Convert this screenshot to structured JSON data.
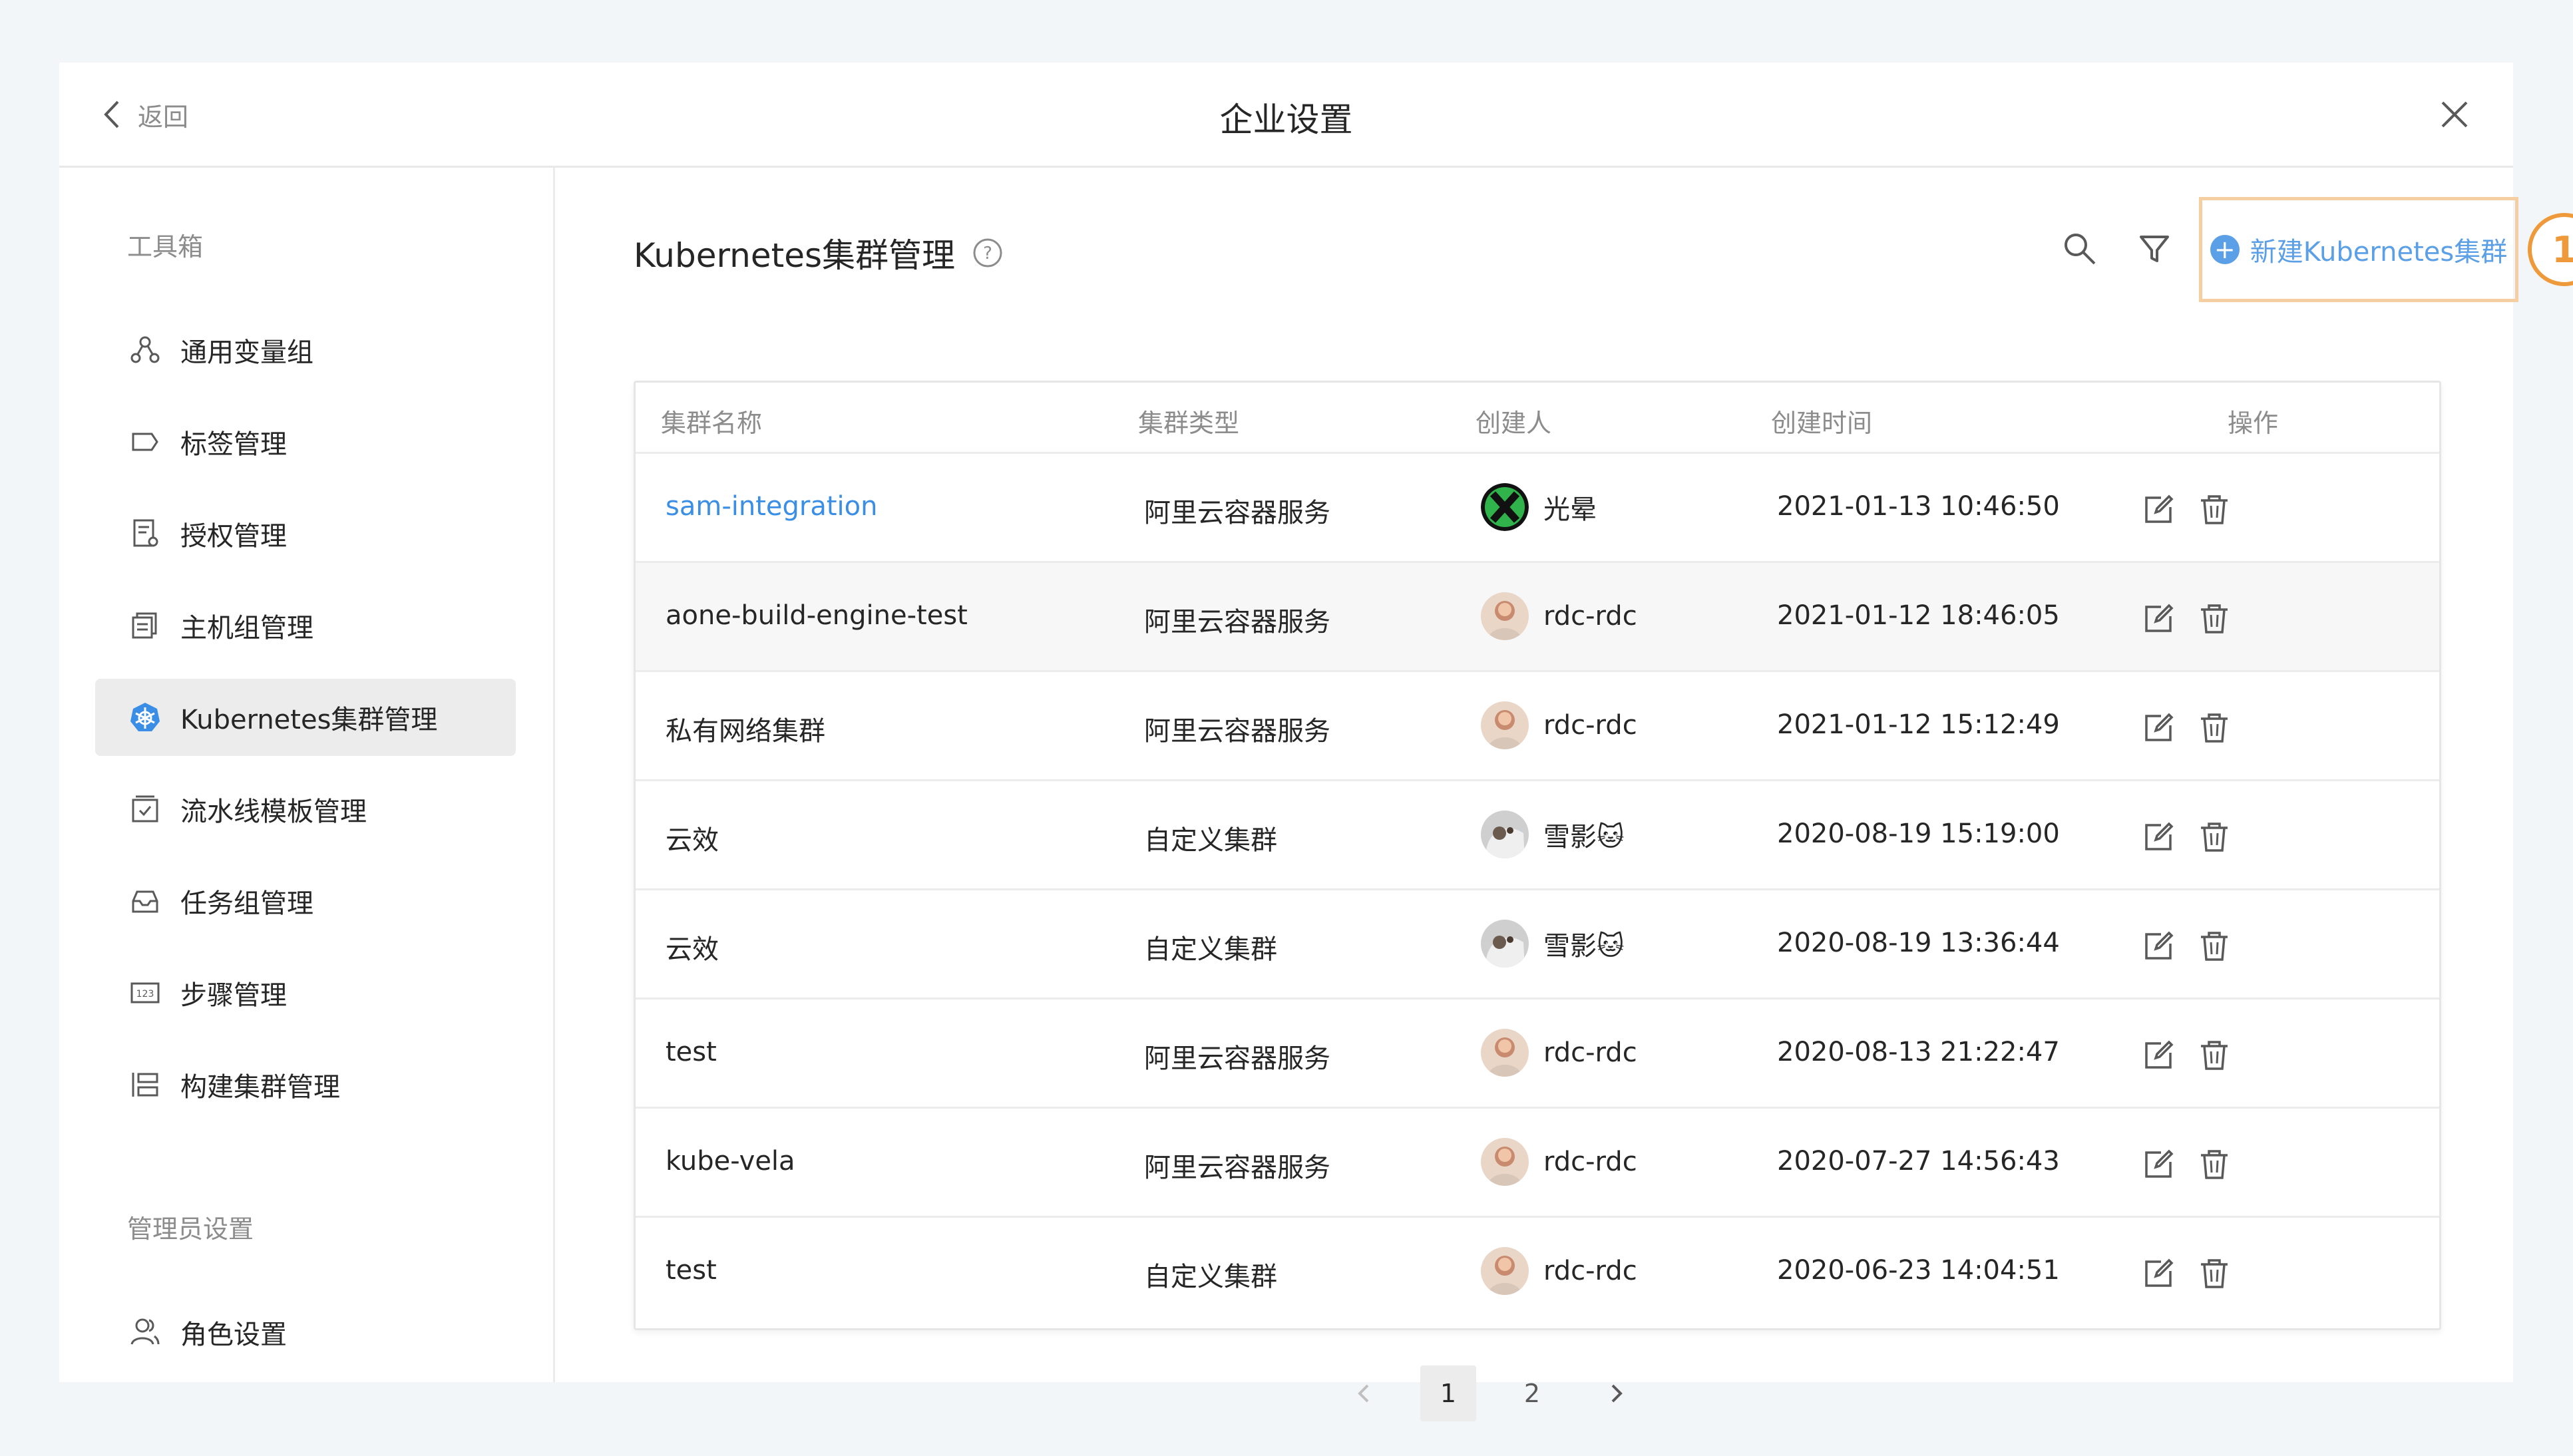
{
  "header": {
    "back_label": "返回",
    "title": "企业设置",
    "close_icon": "close-icon"
  },
  "sidebar": {
    "section_toolbox": "工具箱",
    "items": [
      {
        "label": "通用变量组",
        "icon": "variables-icon"
      },
      {
        "label": "标签管理",
        "icon": "tag-icon"
      },
      {
        "label": "授权管理",
        "icon": "authorization-icon"
      },
      {
        "label": "主机组管理",
        "icon": "host-group-icon"
      },
      {
        "label": "Kubernetes集群管理",
        "icon": "kubernetes-icon",
        "active": true
      },
      {
        "label": "流水线模板管理",
        "icon": "pipeline-template-icon"
      },
      {
        "label": "任务组管理",
        "icon": "task-group-icon"
      },
      {
        "label": "步骤管理",
        "icon": "steps-icon"
      },
      {
        "label": "构建集群管理",
        "icon": "build-cluster-icon"
      }
    ],
    "section_admin": "管理员设置",
    "admin_items": [
      {
        "label": "角色设置",
        "icon": "role-icon"
      }
    ]
  },
  "main": {
    "title": "Kubernetes集群管理",
    "new_button_label": "新建Kubernetes集群",
    "callout_number": "1",
    "accent_color": "#3a8ee6",
    "callout_color": "#ee9a3b"
  },
  "table": {
    "columns": [
      "集群名称",
      "集群类型",
      "创建人",
      "创建时间",
      "操作"
    ],
    "rows": [
      {
        "name": "sam-integration",
        "type": "阿里云容器服务",
        "creator": "光晕",
        "avatar": "x-logo",
        "time": "2021-01-13 10:46:50"
      },
      {
        "name": "aone-build-engine-test",
        "type": "阿里云容器服务",
        "creator": "rdc-rdc",
        "avatar": "photo",
        "time": "2021-01-12 18:46:05"
      },
      {
        "name": "私有网络集群",
        "type": "阿里云容器服务",
        "creator": "rdc-rdc",
        "avatar": "photo",
        "time": "2021-01-12 15:12:49"
      },
      {
        "name": "云效",
        "type": "自定义集群",
        "creator": "雪影🐱",
        "avatar": "cat",
        "time": "2020-08-19 15:19:00"
      },
      {
        "name": "云效",
        "type": "自定义集群",
        "creator": "雪影🐱",
        "avatar": "cat",
        "time": "2020-08-19 13:36:44"
      },
      {
        "name": "test",
        "type": "阿里云容器服务",
        "creator": "rdc-rdc",
        "avatar": "photo",
        "time": "2020-08-13 21:22:47"
      },
      {
        "name": "kube-vela",
        "type": "阿里云容器服务",
        "creator": "rdc-rdc",
        "avatar": "photo",
        "time": "2020-07-27 14:56:43"
      },
      {
        "name": "test",
        "type": "自定义集群",
        "creator": "rdc-rdc",
        "avatar": "photo",
        "time": "2020-06-23 14:04:51"
      }
    ]
  },
  "pagination": {
    "pages": [
      "1",
      "2"
    ],
    "current": "1"
  }
}
